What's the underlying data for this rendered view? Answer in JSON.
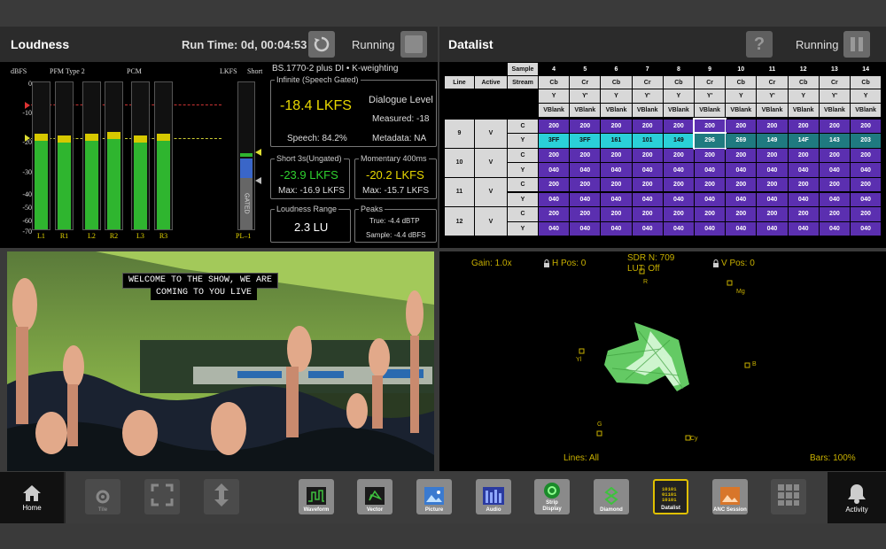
{
  "loudness": {
    "title": "Loudness",
    "runtime_label": "Run Time: 0d, 00:04:53",
    "status": "Running",
    "dbfs_label": "dBFS",
    "pfm_label": "PFM Type 2",
    "pcm_label": "PCM",
    "lkfs_label": "LKFS",
    "short_label": "Short",
    "scale": [
      "0",
      "-10",
      "-20",
      "-30",
      "-40",
      "-50",
      "-60",
      "-70"
    ],
    "channels": [
      {
        "label": "L1",
        "level": 0.62
      },
      {
        "label": "R1",
        "level": 0.61
      },
      {
        "label": "L2",
        "level": 0.62
      },
      {
        "label": "R2",
        "level": 0.63
      },
      {
        "label": "L3",
        "level": 0.61
      },
      {
        "label": "R3",
        "level": 0.62
      }
    ],
    "pl_label": "PL–1",
    "gated_label": "GATED",
    "standard": "BS.1770-2 plus DI • K-weighting",
    "infinite_caption": "Infinite (Speech Gated)",
    "infinite_value": "-18.4 LKFS",
    "dialogue_label": "Dialogue Level",
    "measured": "Measured: -18",
    "speech": "Speech: 84.2%",
    "metadata": "Metadata: NA",
    "short_caption": "Short 3s(Ungated)",
    "short_value": "-23.9 LKFS",
    "short_max": "Max: -16.9 LKFS",
    "momentary_caption": "Momentary 400ms",
    "momentary_value": "-20.2 LKFS",
    "momentary_max": "Max: -15.7 LKFS",
    "range_caption": "Loudness Range",
    "range_value": "2.3 LU",
    "peaks_caption": "Peaks",
    "peaks_true": "True: -4.4 dBTP",
    "peaks_sample": "Sample: -4.4 dBFS"
  },
  "datalist": {
    "title": "Datalist",
    "status": "Running",
    "headers": [
      "Line",
      "Active",
      "Stream"
    ],
    "sample_label": "Sample",
    "samples": [
      "4",
      "5",
      "6",
      "7",
      "8",
      "9",
      "10",
      "11",
      "12",
      "13",
      "14"
    ],
    "chroma_row": [
      "Cb",
      "Cr",
      "Cb",
      "Cr",
      "Cb",
      "Cr",
      "Cb",
      "Cr",
      "Cb",
      "Cr",
      "Cb"
    ],
    "luma_row": [
      "Y",
      "Y'",
      "Y",
      "Y'",
      "Y",
      "Y'",
      "Y",
      "Y'",
      "Y",
      "Y'",
      "Y"
    ],
    "vblank": "VBlank",
    "lines": [
      {
        "line": "9",
        "active": "V",
        "c": [
          "200",
          "200",
          "200",
          "200",
          "200",
          "200",
          "200",
          "200",
          "200",
          "200",
          "200"
        ],
        "y": [
          "3FF",
          "3FF",
          "161",
          "101",
          "149",
          "296",
          "269",
          "149",
          "14F",
          "143",
          "203"
        ]
      },
      {
        "line": "10",
        "active": "V",
        "c": [
          "200",
          "200",
          "200",
          "200",
          "200",
          "200",
          "200",
          "200",
          "200",
          "200",
          "200"
        ],
        "y": [
          "040",
          "040",
          "040",
          "040",
          "040",
          "040",
          "040",
          "040",
          "040",
          "040",
          "040"
        ]
      },
      {
        "line": "11",
        "active": "V",
        "c": [
          "200",
          "200",
          "200",
          "200",
          "200",
          "200",
          "200",
          "200",
          "200",
          "200",
          "200"
        ],
        "y": [
          "040",
          "040",
          "040",
          "040",
          "040",
          "040",
          "040",
          "040",
          "040",
          "040",
          "040"
        ]
      },
      {
        "line": "12",
        "active": "V",
        "c": [
          "200",
          "200",
          "200",
          "200",
          "200",
          "200",
          "200",
          "200",
          "200",
          "200",
          "200"
        ],
        "y": [
          "040",
          "040",
          "040",
          "040",
          "040",
          "040",
          "040",
          "040",
          "040",
          "040",
          "040"
        ]
      }
    ]
  },
  "picture": {
    "caption_line1": "WELCOME TO THE SHOW, WE ARE",
    "caption_line2": "COMING TO YOU LIVE"
  },
  "vector": {
    "gain": "Gain: 1.0x",
    "hpos": "H Pos: 0",
    "sdr": "SDR N: 709",
    "lut": "LUT: Off",
    "vpos": "V Pos: 0",
    "lines": "Lines: All",
    "bars": "Bars: 100%",
    "targets": [
      "R",
      "Mg",
      "B",
      "Cy",
      "G",
      "Yl"
    ]
  },
  "toolbar": {
    "home": "Home",
    "tile": "Tile",
    "waveform": "Waveform",
    "vector": "Vector",
    "picture": "Picture",
    "audio": "Audio",
    "strip_line1": "Strip",
    "strip_line2": "Display",
    "diamond": "Diamond",
    "datalist": "Datalist",
    "anc": "ANC Session",
    "activity": "Activity"
  }
}
